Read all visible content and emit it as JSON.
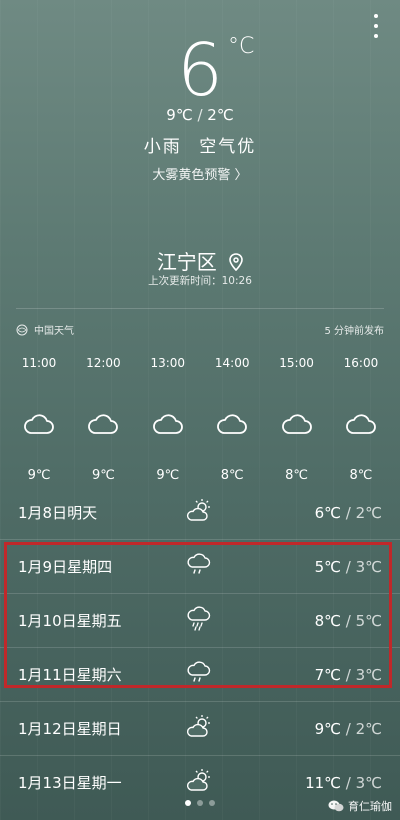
{
  "current": {
    "temp": "6",
    "deg_unit": "°C",
    "high": "9℃",
    "low": "2℃",
    "condition": "小雨",
    "air": "空气优",
    "alert": "大雾黄色预警 〉"
  },
  "location": {
    "name": "江宁区",
    "updated": "上次更新时间：10:26"
  },
  "source": {
    "name": "中国天气",
    "published": "5 分钟前发布"
  },
  "hourly": [
    {
      "time": "11:00",
      "temp": "9℃",
      "icon": "cloud-icon"
    },
    {
      "time": "12:00",
      "temp": "9℃",
      "icon": "cloud-icon"
    },
    {
      "time": "13:00",
      "temp": "9℃",
      "icon": "cloud-icon"
    },
    {
      "time": "14:00",
      "temp": "8℃",
      "icon": "cloud-icon"
    },
    {
      "time": "15:00",
      "temp": "8℃",
      "icon": "cloud-icon"
    },
    {
      "time": "16:00",
      "temp": "8℃",
      "icon": "cloud-icon"
    }
  ],
  "daily": [
    {
      "date": "1月8日明天",
      "high": "6℃",
      "low": "2℃",
      "icon": "partly-cloudy-icon"
    },
    {
      "date": "1月9日星期四",
      "high": "5℃",
      "low": "3℃",
      "icon": "light-rain-icon"
    },
    {
      "date": "1月10日星期五",
      "high": "8℃",
      "low": "5℃",
      "icon": "heavy-rain-icon"
    },
    {
      "date": "1月11日星期六",
      "high": "7℃",
      "low": "3℃",
      "icon": "light-rain-icon"
    },
    {
      "date": "1月12日星期日",
      "high": "9℃",
      "low": "2℃",
      "icon": "partly-cloudy-icon"
    },
    {
      "date": "1月13日星期一",
      "high": "11℃",
      "low": "3℃",
      "icon": "partly-cloudy-icon"
    }
  ],
  "watermark": "育仁瑜伽",
  "colors": {
    "highlight": "#c0282a"
  }
}
